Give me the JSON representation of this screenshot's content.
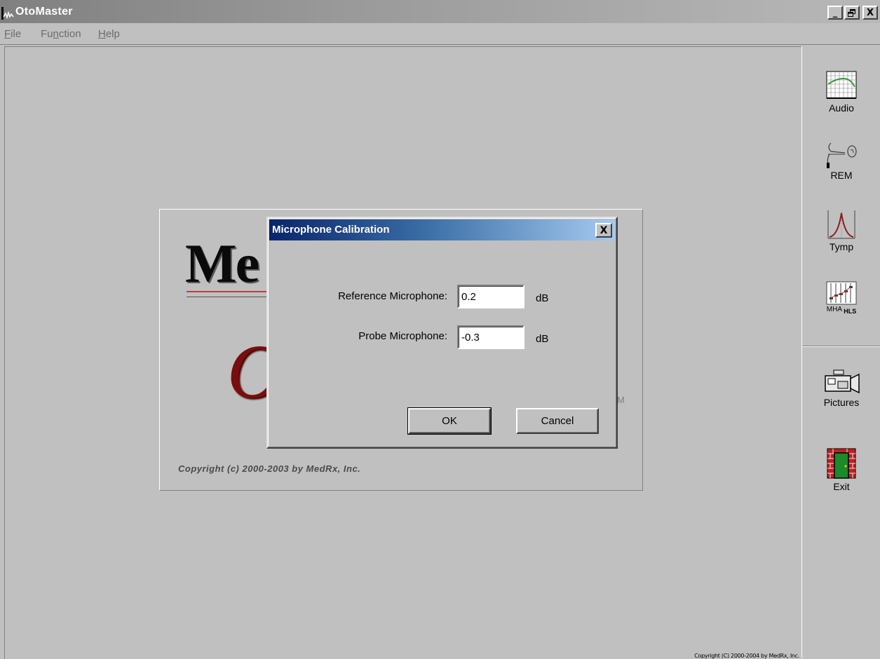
{
  "window": {
    "title": "OtoMaster",
    "controls": {
      "minimize": "_",
      "maximize": "🗗",
      "close": "X"
    }
  },
  "menu": [
    {
      "label": "File",
      "accel": "F",
      "rest": "ile"
    },
    {
      "label": "Function",
      "pre": "Fu",
      "accel": "n",
      "rest": "ction"
    },
    {
      "label": "Help",
      "accel": "H",
      "rest": "elp"
    }
  ],
  "sidebar": {
    "tools": [
      {
        "label": "Audio",
        "icon": "audiogram-icon"
      },
      {
        "label": "REM",
        "icon": "ear-probe-icon"
      },
      {
        "label": "Tymp",
        "icon": "tympanogram-icon"
      },
      {
        "label": "MHA",
        "sub": "HLS",
        "icon": "mixer-sliders-icon"
      },
      {
        "label": "Pictures",
        "icon": "video-camera-icon"
      },
      {
        "label": "Exit",
        "icon": "brick-door-icon"
      }
    ]
  },
  "splash": {
    "logo_text": "Me",
    "script_text": "O",
    "tm": "M",
    "copyright": "Copyright (c) 2000-2003 by MedRx, Inc."
  },
  "dialog": {
    "title": "Microphone Calibration",
    "close": "X",
    "fields": [
      {
        "label": "Reference Microphone:",
        "value": "0.2",
        "unit": "dB"
      },
      {
        "label": "Probe Microphone:",
        "value": "-0.3",
        "unit": "dB"
      }
    ],
    "ok_label": "OK",
    "cancel_label": "Cancel"
  },
  "footer": {
    "copyright": "Copyright (C) 2000-2004 by MedRx, Inc."
  },
  "colors": {
    "face": "#c0c0c0",
    "dialog_title_start": "#0a246a",
    "dialog_title_end": "#a6caf0",
    "brand_red": "#7a0d0d"
  }
}
